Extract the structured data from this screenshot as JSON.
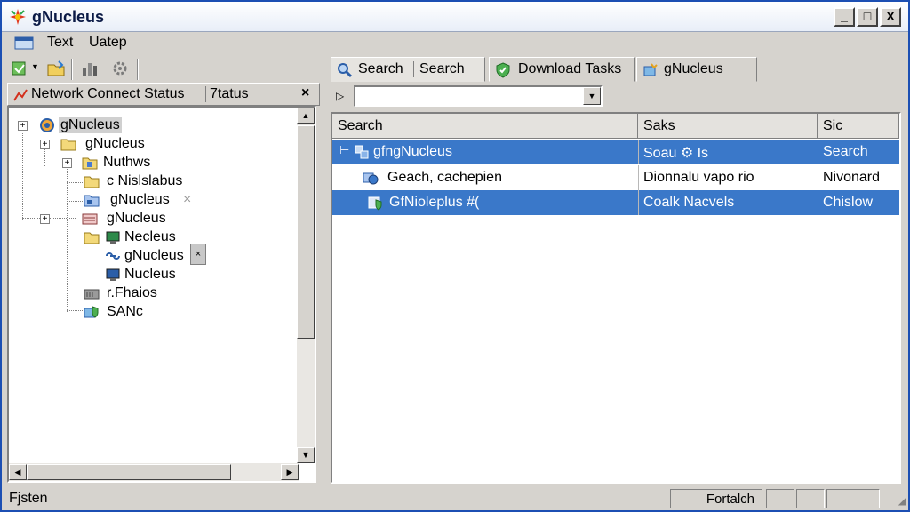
{
  "window": {
    "title": "gNucleus",
    "controls": {
      "minimize": "_",
      "maximize": "□",
      "close": "X"
    }
  },
  "menu": {
    "items": [
      "Text",
      "Uatep"
    ]
  },
  "left_pane": {
    "tab_label": "Network Connect Status",
    "tab_label2": "7tatus",
    "close": "×",
    "tree": [
      {
        "label": "gNucleus",
        "icon": "nucleus-globe-icon",
        "level": 0,
        "expander": "+"
      },
      {
        "label": "gNucleus",
        "icon": "folder-icon",
        "level": 1,
        "expander": "+"
      },
      {
        "label": "Nuthws",
        "icon": "folder-doc-icon",
        "level": 2,
        "expander": "+"
      },
      {
        "label": "c Nislslabus",
        "icon": "folder-icon",
        "level": 3
      },
      {
        "label": "gNucleus",
        "icon": "folder-net-icon",
        "level": 3,
        "suffix": "×"
      },
      {
        "label": "gNucleus",
        "icon": "network-folder-icon",
        "level": 2,
        "expander": "+"
      },
      {
        "label": "Necleus",
        "icon": "monitor-icon",
        "level": 3
      },
      {
        "label": "gNucleus",
        "icon": "link-icon",
        "level": 4
      },
      {
        "label": "Nucleus",
        "icon": "monitor-icon",
        "level": 3
      },
      {
        "label": "r.Fhaios",
        "icon": "server-icon",
        "level": 3
      },
      {
        "label": "SANc",
        "icon": "shield-icon",
        "level": 3
      }
    ]
  },
  "tabs": [
    {
      "label": "Search",
      "label2": "Search",
      "icon": "search-icon"
    },
    {
      "label": "Download Tasks",
      "icon": "shield-download-icon"
    },
    {
      "label": "gNucleus",
      "icon": "nucleus-icon"
    }
  ],
  "search": {
    "value": "",
    "placeholder": ""
  },
  "results": {
    "columns": [
      "Search",
      "Saks",
      "Sic"
    ],
    "rows": [
      {
        "c1": "gfngNucleus",
        "c2": "Soau ⚙ Is",
        "c3": "Search",
        "selected": true,
        "icon": "network-tree-icon"
      },
      {
        "c1": "Geach, cachepien",
        "c2": "Dionnalu vapo rio",
        "c3": "Nivonard",
        "selected": false,
        "icon": "folder-globe-icon"
      },
      {
        "c1": "GfNioleplus #(",
        "c2": "Coalk Nacvels",
        "c3": "Chislow",
        "selected": true,
        "icon": "shield-icon"
      }
    ]
  },
  "status": {
    "left": "Fjsten",
    "panel": "Fortalch"
  },
  "colors": {
    "selection": "#3a78c9",
    "titlebar_border": "#1c4fb3",
    "face": "#d6d3ce"
  }
}
